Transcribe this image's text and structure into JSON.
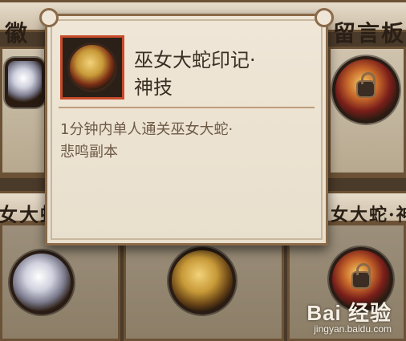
{
  "background": {
    "top_banners": [
      {
        "text": "徽",
        "name": "banner-badge"
      },
      {
        "text": "留言板",
        "name": "banner-message-board"
      }
    ],
    "bottom_banner_texts": [
      {
        "text": "女大蛇",
        "name": "banner-left"
      },
      {
        "text": "女大蛇·神",
        "name": "banner-right"
      }
    ]
  },
  "tooltip": {
    "title": "巫女大蛇印记·\n神技",
    "description": "1分钟内单人通关巫女大蛇·\n悲鸣副本"
  },
  "watermark": {
    "brand": "Bai 经验",
    "url": "jingyan.baidu.com"
  }
}
